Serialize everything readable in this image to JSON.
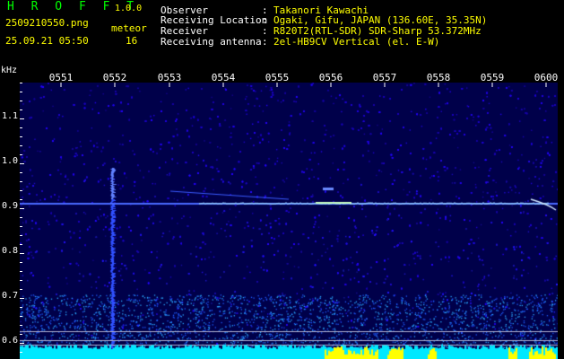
{
  "header": {
    "app_title": "H R O F F T",
    "app_version": "1.0.0",
    "file_name": "2509210550.png",
    "type_label": "meteor",
    "datetime": "25.09.21 05:50",
    "meteor_count": "16"
  },
  "station_info": [
    {
      "label": "Observer",
      "value": "Takanori Kawachi"
    },
    {
      "label": "Receiving Location",
      "value": "Ogaki, Gifu, JAPAN (136.60E, 35.35N)"
    },
    {
      "label": "Receiver",
      "value": "R820T2(RTL-SDR) SDR-Sharp 53.372MHz"
    },
    {
      "label": "Receiving antenna",
      "value": "2el-HB9CV Vertical (el. E-W)"
    }
  ],
  "separator": ":",
  "axis": {
    "unit_label": "kHz",
    "time_ticks": [
      "0551",
      "0552",
      "0553",
      "0554",
      "0555",
      "0556",
      "0557",
      "0558",
      "0559",
      "0600"
    ],
    "freq_ticks": [
      "1.1",
      "1.0",
      "0.9",
      "0.8",
      "0.7",
      "0.6"
    ]
  },
  "colors": {
    "title": "#00ff00",
    "text_yellow": "#ffff00",
    "text_white": "#ffffff",
    "background": "#000000",
    "noise_blue": "#1a2aff",
    "signal_cyan": "#00ffff",
    "signal_yellow": "#ffff00"
  }
}
